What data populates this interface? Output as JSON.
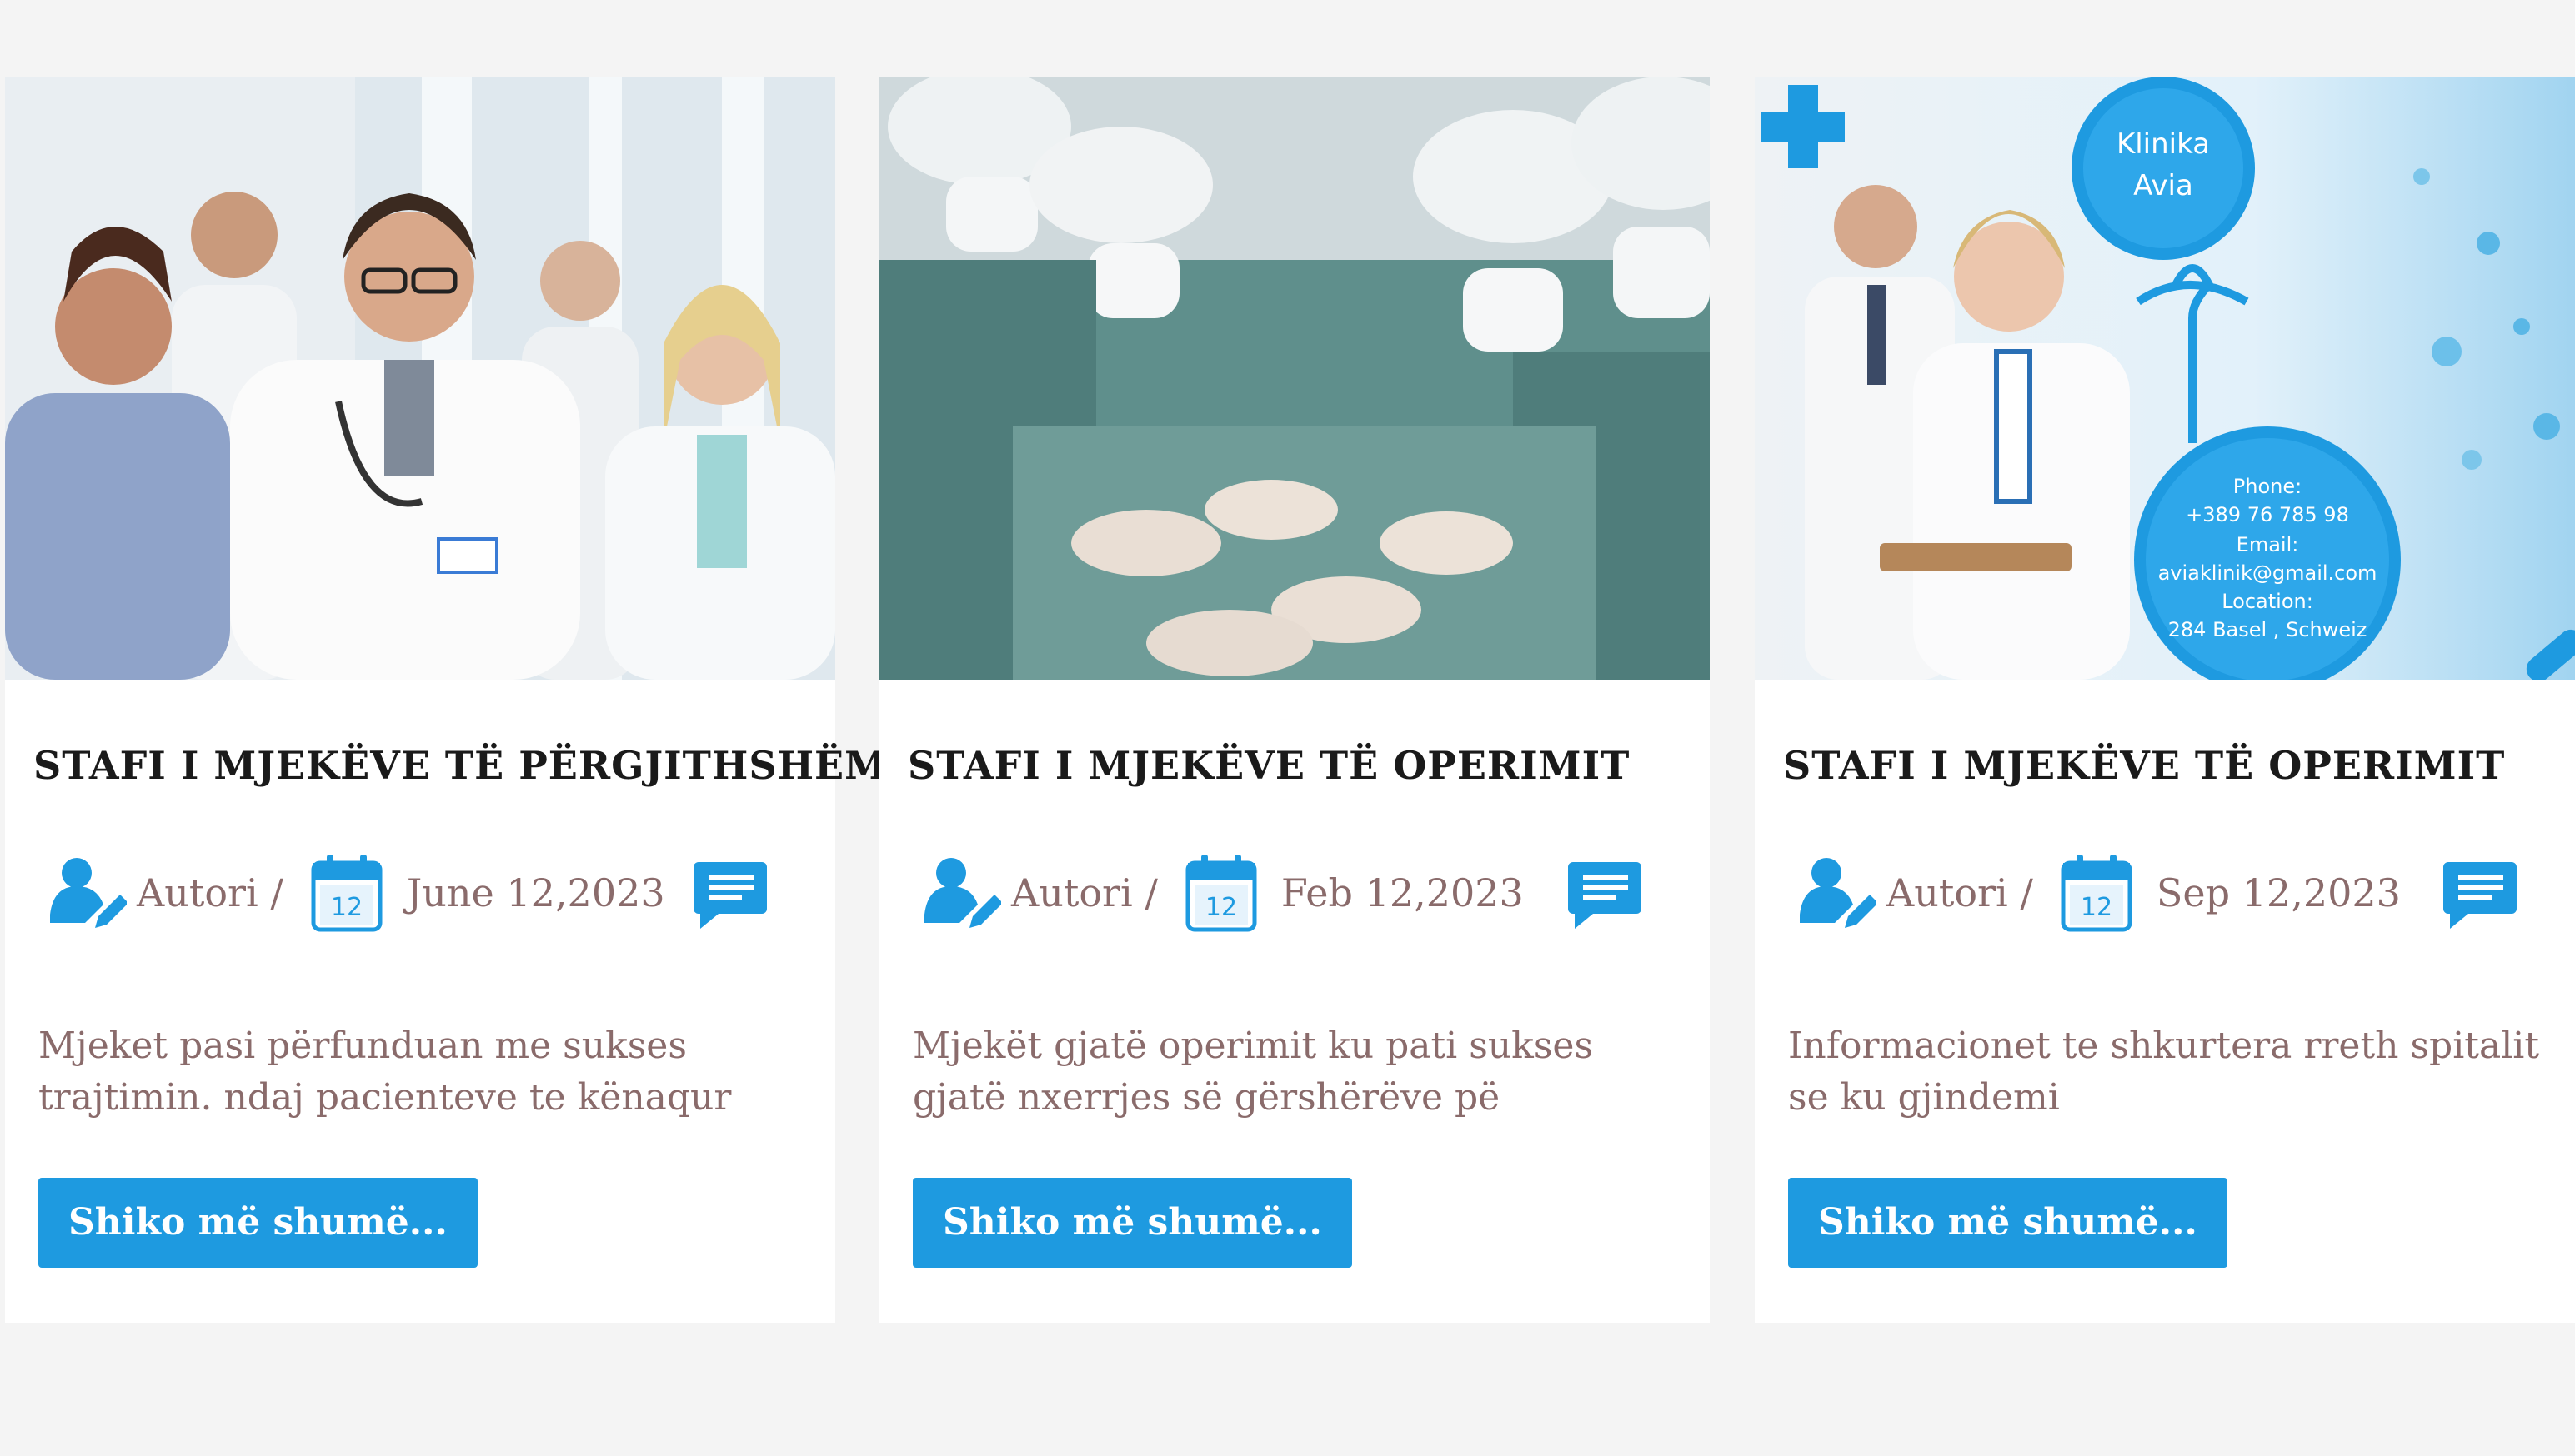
{
  "posts": [
    {
      "title": "STAFI I MJEKËVE TË PËRGJITHSHËM",
      "author": "Autori /",
      "date": "June 12,2023",
      "calendar_day": "12",
      "excerpt": "Mjeket pasi përfunduan me sukses trajtimin. ndaj pacienteve te kënaqur",
      "button": "Shiko më shumë..."
    },
    {
      "title": "STAFI I MJEKËVE TË OPERIMIT",
      "author": "Autori /",
      "date": "Feb 12,2023",
      "calendar_day": "12",
      "excerpt": "Mjekët gjatë operimit ku pati sukses gjatë nxerrjes së gërshërëve pë",
      "button": "Shiko më shumë..."
    },
    {
      "title": "STAFI I MJEKËVE TË OPERIMIT",
      "author": "Autori /",
      "date": "Sep 12,2023",
      "calendar_day": "12",
      "excerpt": "Informacionet te shkurtera rreth spitalit se ku gjindemi",
      "button": "Shiko më shumë...",
      "image_text": {
        "clinic": [
          "Klinika",
          "Avia"
        ],
        "contact": [
          "Phone:",
          "+389 76 785 98",
          "Email:",
          "aviaklinik@gmail.com",
          "Location:",
          "284 Basel , Schweiz"
        ]
      }
    }
  ],
  "colors": {
    "accent": "#1e9ae0",
    "text_muted": "#8a6b6b",
    "title": "#1a1a1a",
    "background": "#f4f4f4"
  },
  "icons": {
    "author": "user-edit-icon",
    "date": "calendar-icon",
    "comments": "comment-icon"
  }
}
